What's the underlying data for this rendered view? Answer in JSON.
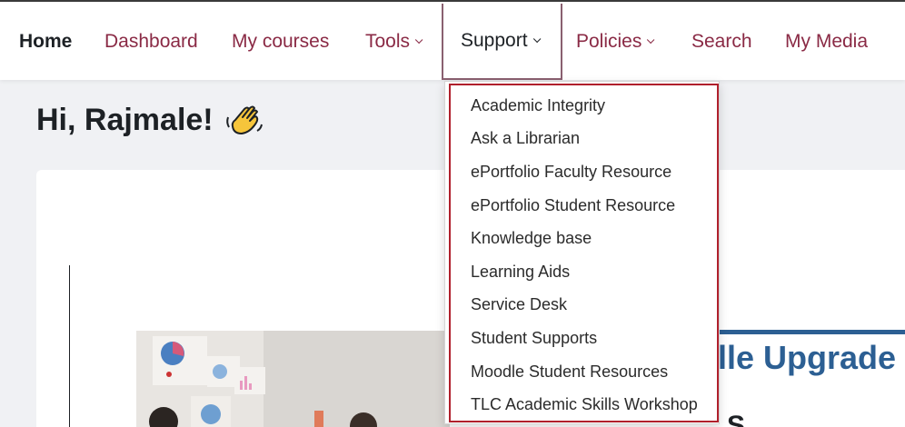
{
  "nav": {
    "items": [
      {
        "label": "Home"
      },
      {
        "label": "Dashboard"
      },
      {
        "label": "My courses"
      },
      {
        "label": "Tools"
      },
      {
        "label": "Support"
      },
      {
        "label": "Policies"
      },
      {
        "label": "Search"
      },
      {
        "label": "My Media"
      }
    ]
  },
  "page": {
    "greeting": "Hi, Rajmale!",
    "banner_title": "lle Upgrade",
    "banner_sub": "S"
  },
  "support_menu": {
    "items": [
      "Academic Integrity",
      "Ask a Librarian",
      "ePortfolio Faculty Resource",
      "ePortfolio Student Resource",
      "Knowledge base",
      "Learning Aids",
      "Service Desk",
      "Student Supports",
      "Moodle Student Resources",
      "TLC Academic Skills Workshop"
    ]
  },
  "colors": {
    "nav_link": "#8a2a45",
    "highlight": "#b0202c",
    "banner": "#2c5f93"
  },
  "icons": {
    "wave": "waving-hand-icon",
    "caret": "chevron-down-icon"
  }
}
